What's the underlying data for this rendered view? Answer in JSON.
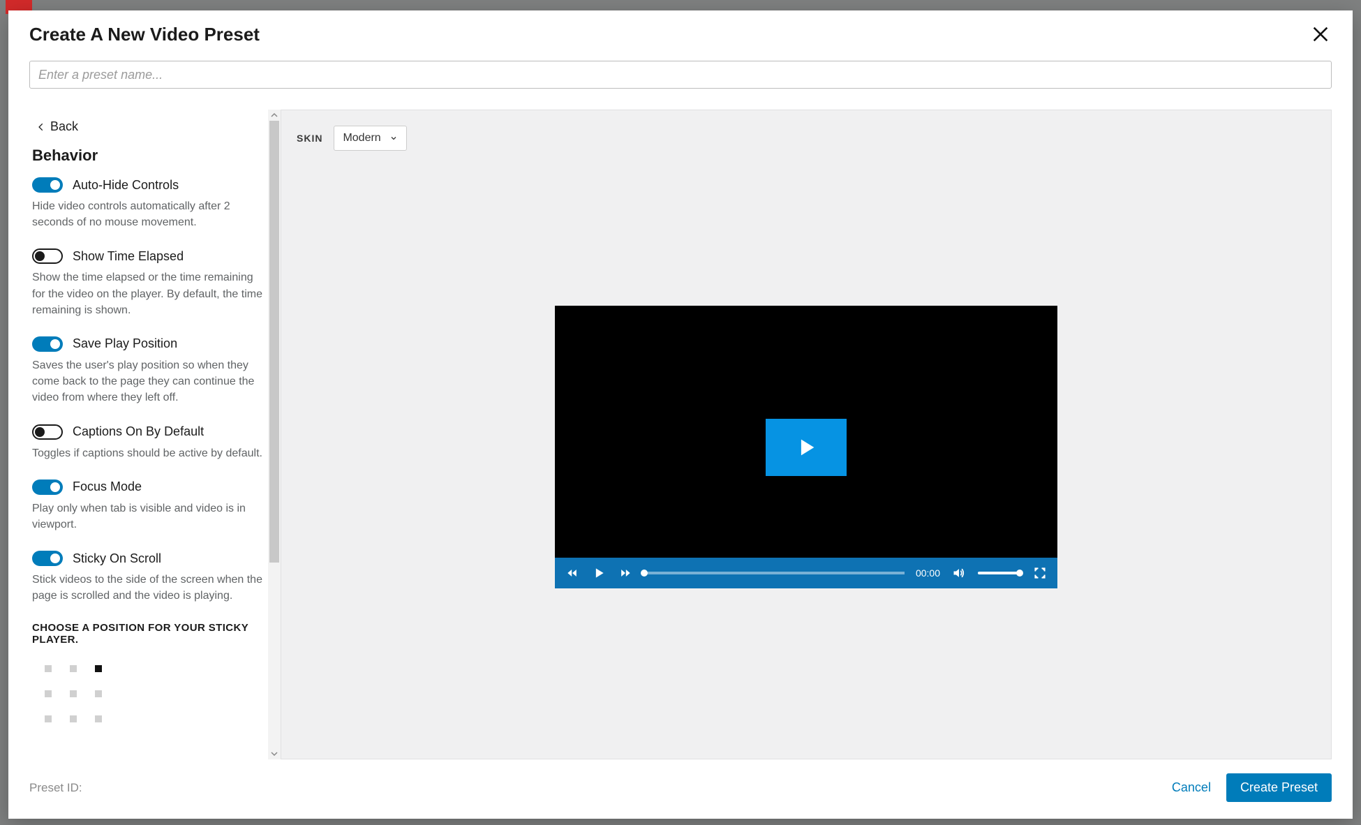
{
  "modal": {
    "title": "Create A New Video Preset",
    "input_placeholder": "Enter a preset name...",
    "input_value": "",
    "preset_id_label": "Preset ID:",
    "cancel_label": "Cancel",
    "submit_label": "Create Preset"
  },
  "sidebar": {
    "back_label": "Back",
    "section_title": "Behavior",
    "options": [
      {
        "key": "autohide",
        "label": "Auto-Hide Controls",
        "on": true,
        "desc": "Hide video controls automatically after 2 seconds of no mouse movement."
      },
      {
        "key": "elapsed",
        "label": "Show Time Elapsed",
        "on": false,
        "desc": "Show the time elapsed or the time remaining for the video on the player. By default, the time remaining is shown."
      },
      {
        "key": "saveplay",
        "label": "Save Play Position",
        "on": true,
        "desc": "Saves the user's play position so when they come back to the page they can continue the video from where they left off."
      },
      {
        "key": "captions",
        "label": "Captions On By Default",
        "on": false,
        "desc": "Toggles if captions should be active by default."
      },
      {
        "key": "focus",
        "label": "Focus Mode",
        "on": true,
        "desc": "Play only when tab is visible and video is in viewport."
      },
      {
        "key": "sticky",
        "label": "Sticky On Scroll",
        "on": true,
        "desc": "Stick videos to the side of the screen when the page is scrolled and the video is playing."
      }
    ],
    "sticky_pos_heading": "CHOOSE A POSITION FOR YOUR STICKY PLAYER.",
    "sticky_selected_index": 2
  },
  "preview": {
    "skin_label": "SKIN",
    "skin_value": "Modern",
    "player": {
      "time": "00:00"
    }
  }
}
